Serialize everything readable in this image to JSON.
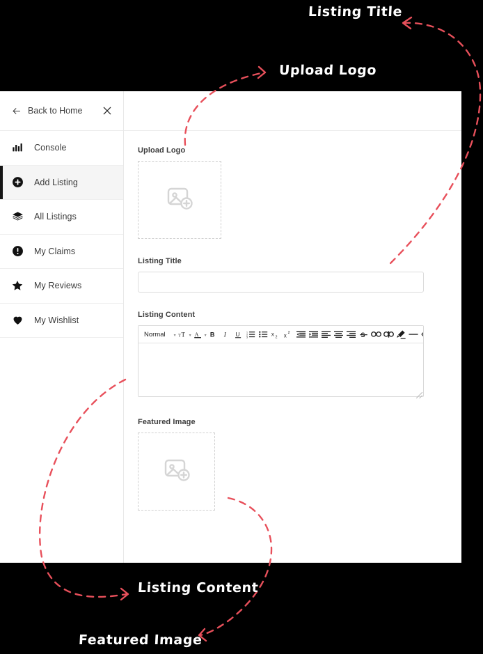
{
  "sidebar": {
    "back_label": "Back to Home",
    "back_icon": "arrow-left-icon",
    "close_icon": "close-icon",
    "items": [
      {
        "label": "Console",
        "icon": "bar-chart-icon",
        "active": false
      },
      {
        "label": "Add Listing",
        "icon": "plus-circle-icon",
        "active": true
      },
      {
        "label": "All Listings",
        "icon": "layers-icon",
        "active": false
      },
      {
        "label": "My Claims",
        "icon": "alert-circle-icon",
        "active": false
      },
      {
        "label": "My Reviews",
        "icon": "star-icon",
        "active": false
      },
      {
        "label": "My Wishlist",
        "icon": "heart-icon",
        "active": false
      }
    ]
  },
  "form": {
    "upload_logo": {
      "label": "Upload Logo",
      "placeholder_icon": "image-plus-icon"
    },
    "listing_title": {
      "label": "Listing Title",
      "value": "",
      "placeholder": ""
    },
    "listing_content": {
      "label": "Listing Content",
      "value": "",
      "toolbar": {
        "format_select": "Normal",
        "buttons": [
          {
            "name": "font-size-icon",
            "glyph": "iT"
          },
          {
            "name": "text-color-icon",
            "glyph": "A"
          },
          {
            "name": "bold-icon",
            "glyph": "B"
          },
          {
            "name": "italic-icon",
            "glyph": "I"
          },
          {
            "name": "underline-icon",
            "glyph": "U"
          },
          {
            "name": "ordered-list-icon",
            "glyph": ""
          },
          {
            "name": "bullet-list-icon",
            "glyph": ""
          },
          {
            "name": "subscript-icon",
            "glyph": "x2"
          },
          {
            "name": "superscript-icon",
            "glyph": "x2"
          },
          {
            "name": "outdent-icon",
            "glyph": ""
          },
          {
            "name": "indent-icon",
            "glyph": ""
          },
          {
            "name": "align-left-icon",
            "glyph": ""
          },
          {
            "name": "align-center-icon",
            "glyph": ""
          },
          {
            "name": "align-right-icon",
            "glyph": ""
          },
          {
            "name": "strikethrough-icon",
            "glyph": "S"
          },
          {
            "name": "link-icon",
            "glyph": ""
          },
          {
            "name": "unlink-icon",
            "glyph": ""
          },
          {
            "name": "highlight-icon",
            "glyph": ""
          },
          {
            "name": "horizontal-rule-icon",
            "glyph": ""
          },
          {
            "name": "source-code-icon",
            "glyph": ""
          }
        ]
      }
    },
    "featured_image": {
      "label": "Featured Image",
      "placeholder_icon": "image-plus-icon"
    }
  },
  "annotations": {
    "accent_color": "#e8505b",
    "text_color": "#ffffff",
    "items": [
      {
        "id": "listing-title",
        "text": "Listing Title"
      },
      {
        "id": "upload-logo",
        "text": "Upload Logo"
      },
      {
        "id": "listing-content",
        "text": "Listing Content"
      },
      {
        "id": "featured-image",
        "text": "Featured Image"
      }
    ]
  }
}
